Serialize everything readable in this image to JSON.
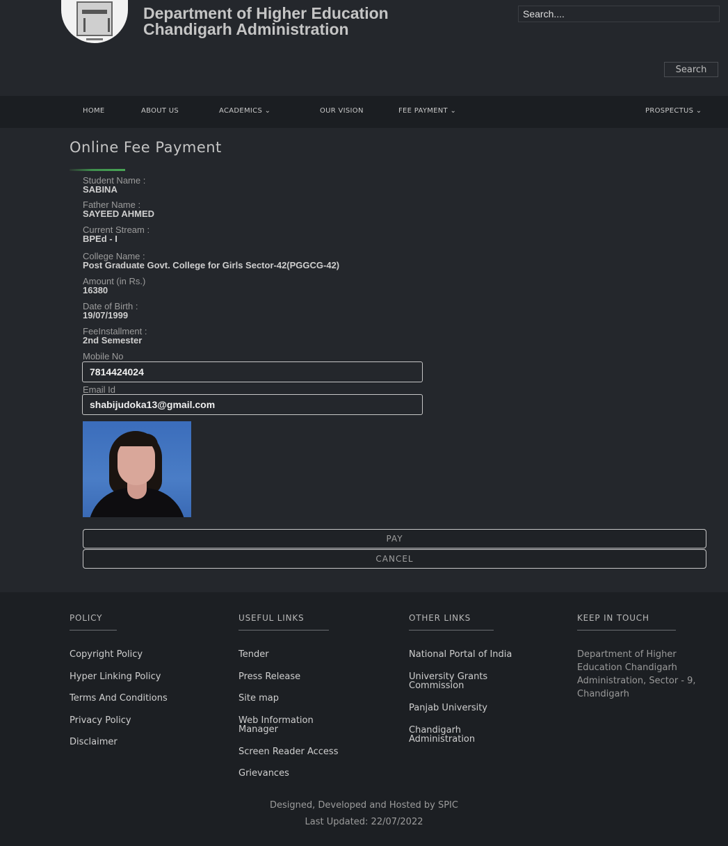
{
  "header": {
    "title_line1": "Department of Higher Education",
    "title_line2": "Chandigarh Administration",
    "search_placeholder": "Search....",
    "search_button": "Search"
  },
  "nav": {
    "items": [
      "HOME",
      "ABOUT US",
      "ACADEMICS ⌄",
      "OUR VISION",
      "FEE PAYMENT ⌄",
      "PROSPECTUS ⌄"
    ]
  },
  "form": {
    "title": "Online Fee Payment",
    "fields": [
      {
        "label": "Student Name :",
        "value": "SABINA"
      },
      {
        "label": "Father Name :",
        "value": "SAYEED AHMED"
      },
      {
        "label": "Current Stream :",
        "value": "BPEd - I"
      },
      {
        "label": "College Name :",
        "value": "Post Graduate Govt. College for Girls Sector-42(PGGCG-42)"
      },
      {
        "label": "Amount (in Rs.)",
        "value": "16380"
      },
      {
        "label": "Date of Birth :",
        "value": "19/07/1999"
      },
      {
        "label": "FeeInstallment :",
        "value": "2nd Semester"
      }
    ],
    "mobile_label": "Mobile No",
    "mobile_value": "7814424024",
    "email_label": "Email Id",
    "email_value": "shabijudoka13@gmail.com",
    "pay_button": "PAY",
    "cancel_button": "CANCEL"
  },
  "footer": {
    "policy": {
      "heading": "POLICY",
      "links": [
        "Copyright Policy",
        "Hyper Linking Policy",
        "Terms And Conditions",
        "Privacy Policy",
        "Disclaimer"
      ]
    },
    "useful": {
      "heading": "USEFUL LINKS",
      "links": [
        "Tender",
        "Press Release",
        "Site map",
        "Web Information\nManager",
        "Screen Reader Access",
        "Grievances"
      ]
    },
    "other": {
      "heading": "OTHER LINKS",
      "links": [
        "National Portal of India",
        "University Grants\nCommission",
        "Panjab University",
        "Chandigarh\nAdministration"
      ]
    },
    "keep": {
      "heading": "KEEP IN TOUCH",
      "address": "Department of Higher Education Chandigarh Administration, Sector - 9, Chandigarh"
    },
    "credit_line1": "Designed, Developed and Hosted by SPIC",
    "credit_line2": "Last Updated: 22/07/2022"
  }
}
